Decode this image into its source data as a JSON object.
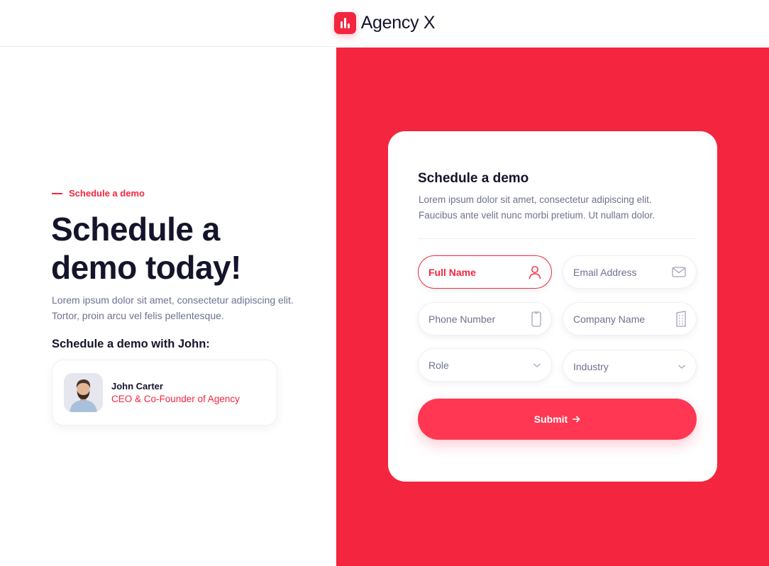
{
  "header": {
    "brand_name": "Agency X",
    "logo_icon": "bar-chart-icon"
  },
  "hero": {
    "eyebrow": "Schedule a demo",
    "title": "Schedule a demo today!",
    "description": "Lorem ipsum dolor sit amet, consectetur adipiscing elit. Tortor, proin arcu vel felis pellentesque.",
    "with_title": "Schedule a demo with John:",
    "person": {
      "name": "John Carter",
      "role": "CEO & Co-Founder of Agency"
    }
  },
  "form": {
    "title": "Schedule a demo",
    "description": "Lorem ipsum dolor sit amet, consectetur adipiscing elit. Faucibus ante velit nunc morbi pretium. Ut nullam dolor.",
    "fields": [
      {
        "label": "Full Name",
        "icon": "user-icon",
        "active": true
      },
      {
        "label": "Email Address",
        "icon": "mail-icon",
        "active": false
      },
      {
        "label": "Phone Number",
        "icon": "phone-icon",
        "active": false
      },
      {
        "label": "Company Name",
        "icon": "building-icon",
        "active": false
      },
      {
        "label": "Role",
        "icon": "chevron-down-icon",
        "active": false
      },
      {
        "label": "Industry",
        "icon": "chevron-down-icon",
        "active": false
      }
    ],
    "submit_label": "Submit",
    "submit_icon": "arrow-right-icon"
  },
  "colors": {
    "accent": "#f4253f",
    "button": "#ff3752",
    "heading": "#14142b",
    "body_text": "#6e7191"
  }
}
